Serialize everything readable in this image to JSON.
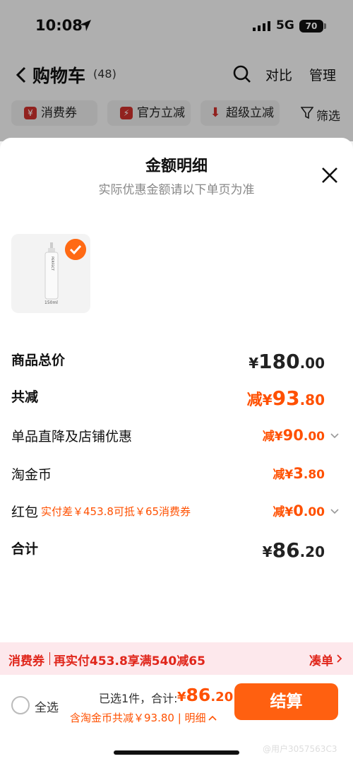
{
  "status_bar": {
    "time": "10:08",
    "network": "5G",
    "battery": "70"
  },
  "nav": {
    "title": "购物车",
    "count": "(48)",
    "compare": "对比",
    "manage": "管理"
  },
  "chips": [
    "消费券",
    "官方立减",
    "超级立减"
  ],
  "filter": "筛选",
  "sheet": {
    "title": "金额明细",
    "subtitle": "实际优惠金额请以下单页为准",
    "product_label": "150ml",
    "bottle_brand": "PERFECT DIARY"
  },
  "rows": {
    "total_price": {
      "label": "商品总价",
      "yen": "¥",
      "int": "180",
      "dec": ".00"
    },
    "total_discount": {
      "label": "共减",
      "prefix": "减",
      "yen": "¥",
      "int": "93",
      "dec": ".80"
    },
    "shop_discount": {
      "label": "单品直降及店铺优惠",
      "prefix": "减",
      "yen": "¥",
      "int": "90",
      "dec": ".00"
    },
    "gold_coin": {
      "label": "淘金币",
      "prefix": "减",
      "yen": "¥",
      "int": "3",
      "dec": ".80"
    },
    "red_packet": {
      "label": "红包",
      "note": "实付差￥453.8可抵￥65消费券",
      "prefix": "减",
      "yen": "¥",
      "int": "0",
      "dec": ".00"
    },
    "sum": {
      "label": "合计",
      "yen": "¥",
      "int": "86",
      "dec": ".20"
    }
  },
  "coupon_bar": {
    "tag": "消费券",
    "text": "再实付453.8享满540减65",
    "link": "凑单"
  },
  "footer": {
    "select_all": "全选",
    "summary": "已选1件，合计:",
    "total": {
      "yen": "¥",
      "int": "86",
      "dec": ".20"
    },
    "discount_line": "含淘金币共减￥93.80 | 明细",
    "checkout": "结算",
    "watermark": "@用户3057563C3"
  },
  "colors": {
    "accent": "#ff5000",
    "coupon": "#e0261b",
    "checkout": "#ff6010"
  }
}
